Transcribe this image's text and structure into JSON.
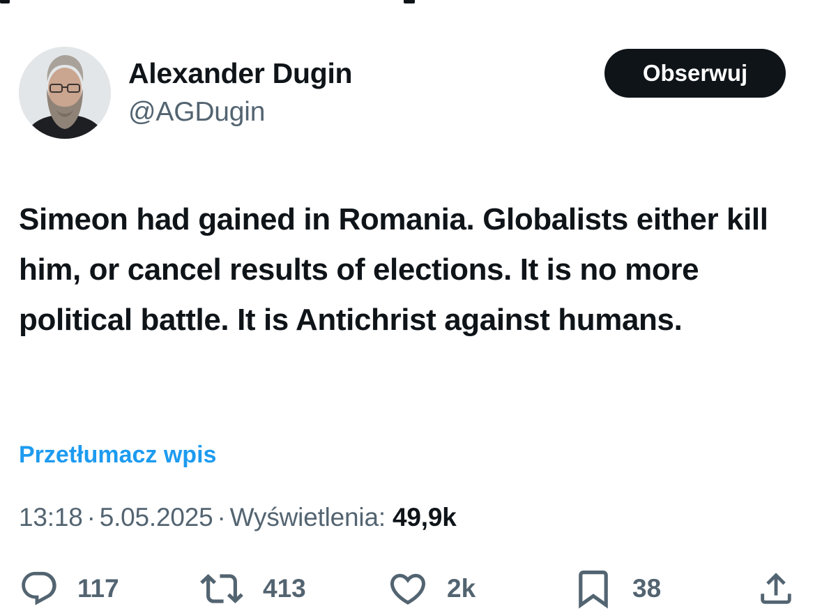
{
  "author": {
    "name": "Alexander Dugin",
    "handle": "@AGDugin"
  },
  "follow_label": "Obserwuj",
  "tweet": {
    "text": "Simeon had gained in Romania. Globalists either kill him, or cancel results of elections. It is no more political battle. It is Antichrist against humans."
  },
  "translate_label": "Przetłumacz wpis",
  "meta": {
    "time": "13:18",
    "date": "5.05.2025",
    "views_label": "Wyświetlenia:",
    "views_count": "49,9k"
  },
  "actions": {
    "replies": "117",
    "reposts": "413",
    "likes": "2k",
    "bookmarks": "38"
  },
  "colors": {
    "text": "#0f1419",
    "secondary": "#536471",
    "link": "#1d9bf0",
    "button_bg": "#0f1419"
  }
}
